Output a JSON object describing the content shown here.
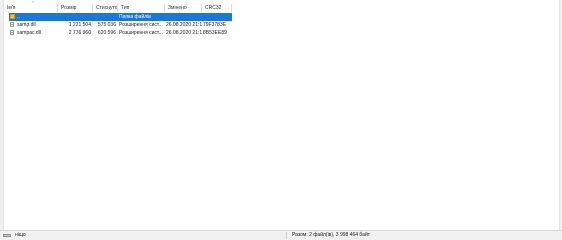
{
  "columns": {
    "name": "Ім'я",
    "size": "Розмір",
    "packed": "Стиснуто",
    "type": "Тип",
    "modified": "Змінено",
    "crc": "CRC32"
  },
  "rows": [
    {
      "name": "..",
      "size": "",
      "packed": "",
      "type": "Папка файлів",
      "modified": "",
      "crc": "",
      "icon": "folder-up-icon"
    },
    {
      "name": "samp.dll",
      "size": "1 221 504",
      "packed": "575 036",
      "type": "Розширення сист...",
      "modified": "26.08.2020 21:12",
      "crc": "79F3783E",
      "icon": "dll-file-icon"
    },
    {
      "name": "sampac.dll",
      "size": "2 776 960",
      "packed": "620 596",
      "type": "Розширення сист...",
      "modified": "26.08.2020 21:12",
      "crc": "8B53EE89",
      "icon": "dll-file-icon"
    }
  ],
  "status": {
    "left": "ніщо",
    "total": "Разом: 2 файл(ів), 3 998 464 байт"
  },
  "colors": {
    "selection": "#1879d6",
    "header_text": "#333333",
    "statusbar_bg": "#f0f0f0"
  }
}
